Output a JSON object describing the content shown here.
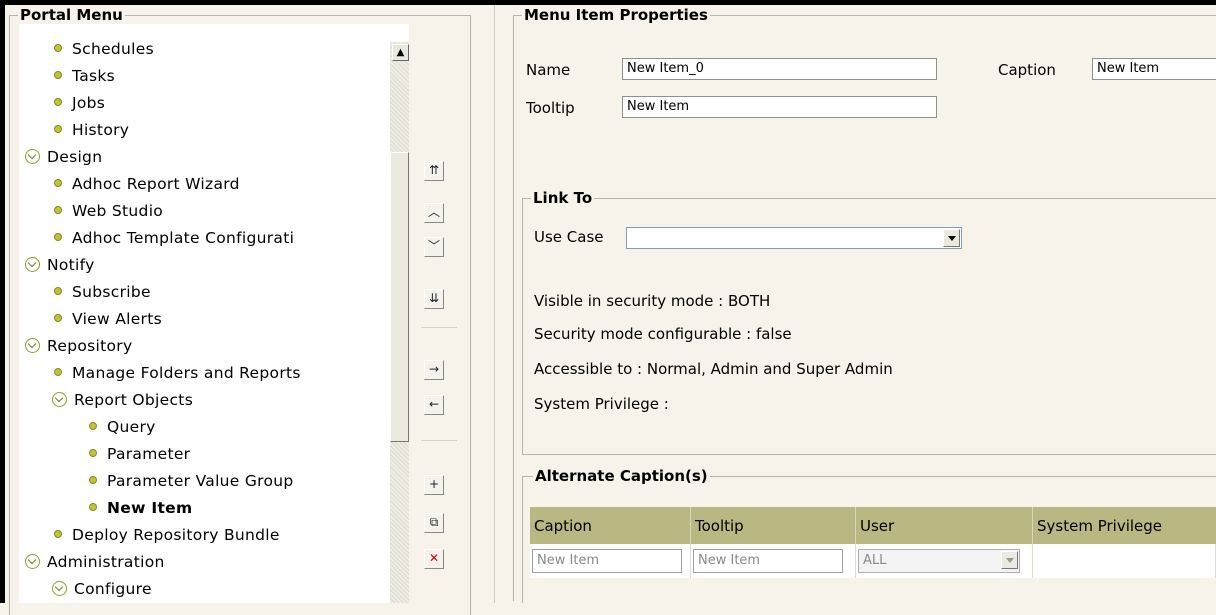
{
  "portal_menu": {
    "title": "Portal Menu",
    "items": [
      {
        "label": "Schedules",
        "type": "leaf",
        "level": 2
      },
      {
        "label": "Tasks",
        "type": "leaf",
        "level": 2
      },
      {
        "label": "Jobs",
        "type": "leaf",
        "level": 2
      },
      {
        "label": "History",
        "type": "leaf",
        "level": 2
      },
      {
        "label": "Design",
        "type": "folder",
        "level": 1
      },
      {
        "label": "Adhoc Report Wizard",
        "type": "leaf",
        "level": 2
      },
      {
        "label": "Web Studio",
        "type": "leaf",
        "level": 2
      },
      {
        "label": "Adhoc Template Configurati",
        "type": "leaf",
        "level": 2
      },
      {
        "label": "Notify",
        "type": "folder",
        "level": 1
      },
      {
        "label": "Subscribe",
        "type": "leaf",
        "level": 2
      },
      {
        "label": "View Alerts",
        "type": "leaf",
        "level": 2
      },
      {
        "label": "Repository",
        "type": "folder",
        "level": 1
      },
      {
        "label": "Manage Folders and Reports",
        "type": "leaf",
        "level": 2
      },
      {
        "label": "Report Objects",
        "type": "folder",
        "level": 2
      },
      {
        "label": "Query",
        "type": "leaf",
        "level": 3
      },
      {
        "label": "Parameter",
        "type": "leaf",
        "level": 3
      },
      {
        "label": "Parameter Value Group",
        "type": "leaf",
        "level": 3
      },
      {
        "label": "New Item",
        "type": "leaf",
        "level": 3,
        "selected": true
      },
      {
        "label": "Deploy Repository Bundle",
        "type": "leaf",
        "level": 2
      },
      {
        "label": "Administration",
        "type": "folder",
        "level": 1
      },
      {
        "label": "Configure",
        "type": "folder",
        "level": 2
      }
    ],
    "toolbar_icons": [
      "move-top-icon",
      "move-up-icon",
      "move-down-icon",
      "move-bottom-icon",
      "indent-icon",
      "outdent-icon",
      "add-icon",
      "copy-icon",
      "delete-icon"
    ]
  },
  "properties": {
    "title": "Menu Item Properties",
    "name_label": "Name",
    "name_value": "New Item_0",
    "caption_label": "Caption",
    "caption_value": "New Item",
    "tooltip_label": "Tooltip",
    "tooltip_value": "New Item"
  },
  "link_to": {
    "title": "Link To",
    "use_case_label": "Use Case",
    "use_case_value": "",
    "visible_mode": "Visible in security mode : BOTH",
    "configurable": "Security mode configurable : false",
    "accessible": "Accessible to : Normal, Admin and Super Admin",
    "privilege": "System Privilege :"
  },
  "alternate_captions": {
    "title": "Alternate Caption(s)",
    "headers": [
      "Caption",
      "Tooltip",
      "User",
      "System Privilege"
    ],
    "row": {
      "caption": "New Item",
      "tooltip": "New Item",
      "user": "ALL"
    }
  },
  "colors": {
    "bullet": "#c2c236",
    "header": "#b9b782",
    "background": "#f7f3ea"
  }
}
